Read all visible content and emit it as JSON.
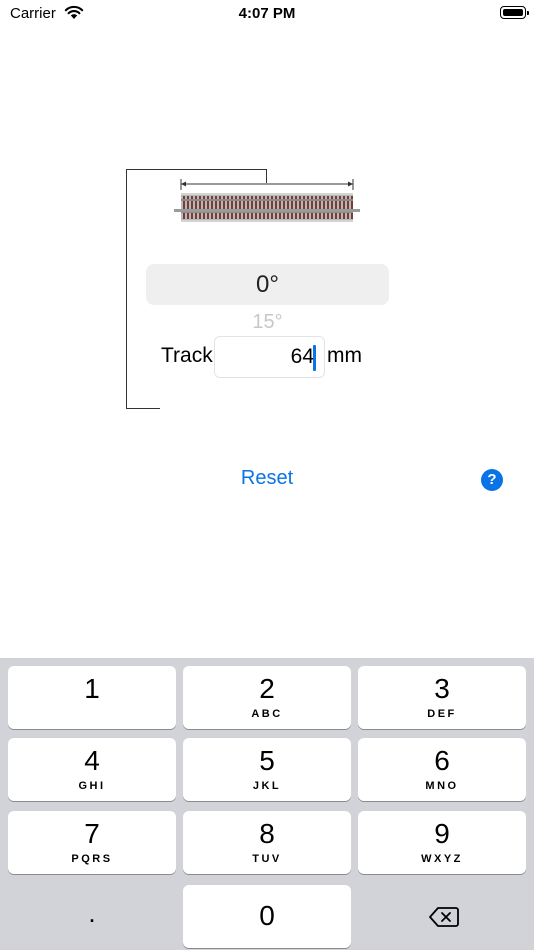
{
  "status_bar": {
    "carrier": "Carrier",
    "time": "4:07 PM"
  },
  "picker": {
    "selected": "0°",
    "next": "15°"
  },
  "track": {
    "label": "Track",
    "value": "64",
    "unit": "mm"
  },
  "actions": {
    "reset": "Reset",
    "help": "?"
  },
  "keyboard": {
    "keys": [
      {
        "num": "1",
        "letters": ""
      },
      {
        "num": "2",
        "letters": "ABC"
      },
      {
        "num": "3",
        "letters": "DEF"
      },
      {
        "num": "4",
        "letters": "GHI"
      },
      {
        "num": "5",
        "letters": "JKL"
      },
      {
        "num": "6",
        "letters": "MNO"
      },
      {
        "num": "7",
        "letters": "PQRS"
      },
      {
        "num": "8",
        "letters": "TUV"
      },
      {
        "num": "9",
        "letters": "WXYZ"
      },
      {
        "num": "0"
      }
    ],
    "decimal": ".",
    "delete_icon": "delete-backward-icon"
  },
  "colors": {
    "accent": "#0a74e6",
    "keyboard_bg": "#d1d3d9"
  }
}
